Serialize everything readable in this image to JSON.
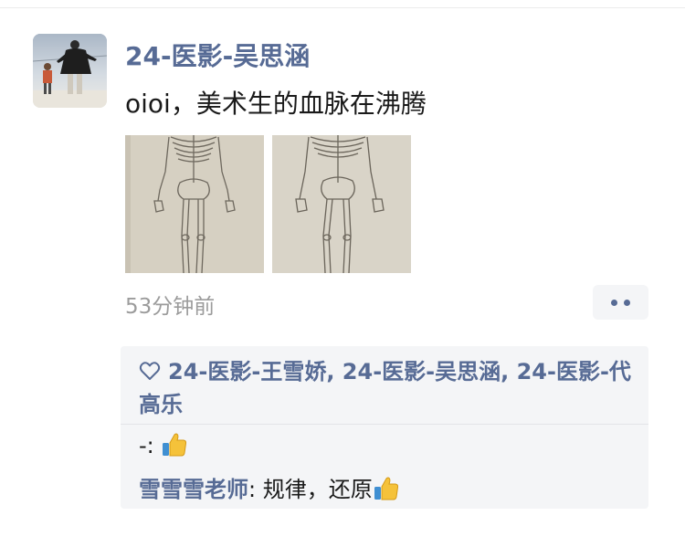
{
  "post": {
    "author": "24-医影-吴思涵",
    "text": "oioi，美术生的血脉在沸腾",
    "timestamp": "53分钟前",
    "photos": [
      {
        "icon": "skeleton-drawing-photo"
      },
      {
        "icon": "skeleton-drawing-photo"
      }
    ]
  },
  "likes": {
    "icon": "heart-icon",
    "names": "24-医影-王雪娇, 24-医影-吴思涵, 24-医影-代高乐"
  },
  "comments": [
    {
      "commenter": "-",
      "separator": ": ",
      "text": "",
      "emoji": "thumbs-up-icon"
    },
    {
      "commenter": "雪雪雪老师",
      "separator": ": ",
      "text": "规律，还原",
      "emoji": "thumbs-up-icon"
    }
  ],
  "colors": {
    "name_link": "#576b95",
    "timestamp": "#9c9c9c",
    "interaction_bg": "#f4f5f7"
  }
}
